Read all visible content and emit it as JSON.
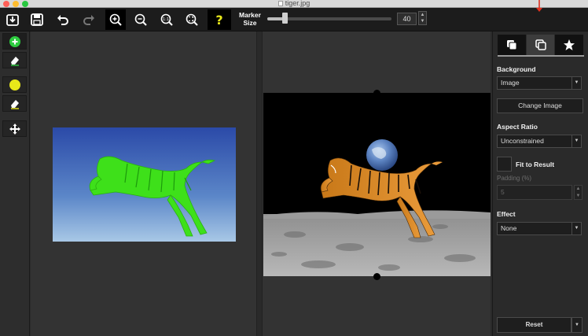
{
  "window": {
    "title": "tiger.jpg"
  },
  "toolbar": {
    "marker_size_label_1": "Marker",
    "marker_size_label_2": "Size",
    "marker_size_value": "40",
    "marker_size_fraction": 0.14
  },
  "panel": {
    "background_label": "Background",
    "background_value": "Image",
    "change_image_label": "Change Image",
    "aspect_ratio_label": "Aspect Ratio",
    "aspect_ratio_value": "Unconstrained",
    "fit_to_result_label": "Fit to Result",
    "padding_label": "Padding (%)",
    "padding_value": "5",
    "effect_label": "Effect",
    "effect_value": "None",
    "reset_label": "Reset"
  },
  "colors": {
    "accent_green": "#2ecc40",
    "highlight_yellow": "#e8e81a",
    "annotation_red": "#e0301e"
  }
}
